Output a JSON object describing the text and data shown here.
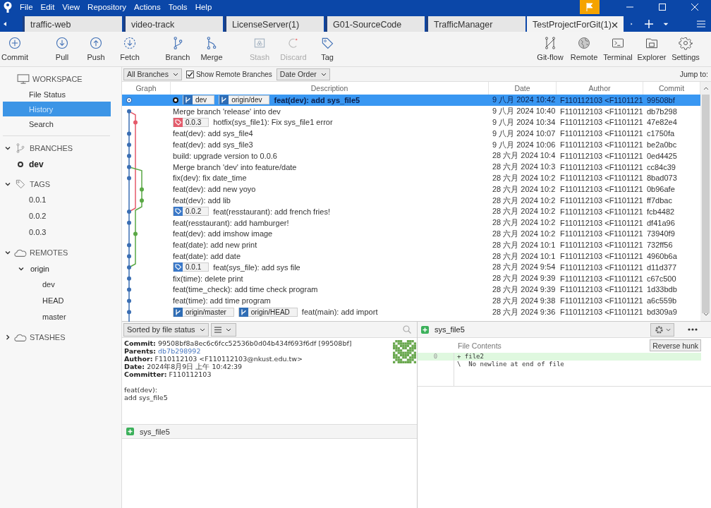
{
  "menu": [
    "File",
    "Edit",
    "View",
    "Repository",
    "Actions",
    "Tools",
    "Help"
  ],
  "tabs": [
    {
      "label": "traffic-web",
      "selected": false
    },
    {
      "label": "video-track",
      "selected": false
    },
    {
      "label": "LicenseServer(1)",
      "selected": false
    },
    {
      "label": "G01-SourceCode",
      "selected": false
    },
    {
      "label": "TrafficManager",
      "selected": false
    },
    {
      "label": "TestProjectForGit(1)",
      "selected": true
    }
  ],
  "toolbar": {
    "left": [
      {
        "label": "Commit",
        "kind": "commit",
        "disabled": false
      },
      {
        "label": "Pull",
        "kind": "pull",
        "disabled": false
      },
      {
        "label": "Push",
        "kind": "push",
        "disabled": false
      },
      {
        "label": "Fetch",
        "kind": "fetch",
        "disabled": false
      },
      {
        "label": "Branch",
        "kind": "branch",
        "disabled": false
      },
      {
        "label": "Merge",
        "kind": "merge",
        "disabled": false
      },
      {
        "label": "Stash",
        "kind": "stash",
        "disabled": true
      },
      {
        "label": "Discard",
        "kind": "discard",
        "disabled": true
      },
      {
        "label": "Tag",
        "kind": "tag",
        "disabled": false
      }
    ],
    "right": [
      {
        "label": "Git-flow",
        "kind": "gitflow",
        "disabled": false
      },
      {
        "label": "Remote",
        "kind": "remote",
        "disabled": false
      },
      {
        "label": "Terminal",
        "kind": "terminal",
        "disabled": false
      },
      {
        "label": "Explorer",
        "kind": "explorer",
        "disabled": false
      },
      {
        "label": "Settings",
        "kind": "settings",
        "disabled": false
      }
    ]
  },
  "sidebar": [
    {
      "title": "WORKSPACE",
      "kind": "workspace",
      "items": [
        {
          "label": "File Status",
          "selected": false
        },
        {
          "label": "History",
          "selected": true
        },
        {
          "label": "Search",
          "selected": false
        }
      ]
    },
    {
      "title": "BRANCHES",
      "kind": "branches",
      "expanded": true,
      "items": [
        {
          "label": "dev",
          "current": true
        }
      ]
    },
    {
      "title": "TAGS",
      "kind": "tags",
      "expanded": true,
      "items": [
        {
          "label": "0.0.1"
        },
        {
          "label": "0.0.2"
        },
        {
          "label": "0.0.3"
        }
      ]
    },
    {
      "title": "REMOTES",
      "kind": "remotes",
      "expanded": true,
      "items": [
        {
          "label": "origin",
          "expanded": true,
          "children": [
            {
              "label": "dev"
            },
            {
              "label": "HEAD"
            },
            {
              "label": "master"
            }
          ]
        }
      ]
    },
    {
      "title": "STASHES",
      "kind": "stashes",
      "expanded": false
    }
  ],
  "filters": {
    "branches": "All Branches",
    "show_remote": {
      "label": "Show Remote Branches",
      "checked": true
    },
    "order": "Date Order",
    "jump_label": "Jump to:"
  },
  "table": {
    "columns": [
      "Graph",
      "Description",
      "Date",
      "Author",
      "Commit"
    ],
    "rows": [
      {
        "selected": true,
        "head": true,
        "refs": [
          {
            "kind": "branch",
            "label": "dev"
          },
          {
            "kind": "branch",
            "label": "origin/dev"
          }
        ],
        "description": "feat(dev): add sys_file5",
        "date": "9 八月 2024 10:42",
        "author": "F110112103 <F1101121",
        "commit": "99508bf"
      },
      {
        "selected": false,
        "head": false,
        "description": "Merge branch 'release' into dev",
        "date": "9 八月 2024 10:40",
        "author": "F110112103 <F1101121",
        "commit": "db7b298"
      },
      {
        "selected": false,
        "head": false,
        "refs": [
          {
            "kind": "tag",
            "label": "0.0.3",
            "color": "#e45c6c"
          }
        ],
        "description": "hotfix(sys_file1): Fix sys_file1 error",
        "date": "9 八月 2024 10:34",
        "author": "F110112103 <F1101121",
        "commit": "47e82e4"
      },
      {
        "selected": false,
        "head": false,
        "description": "feat(dev): add sys_file4",
        "date": "9 八月 2024 10:07",
        "author": "F110112103 <F1101121",
        "commit": "c1750fa"
      },
      {
        "selected": false,
        "head": false,
        "description": "feat(dev): add sys_file3",
        "date": "9 八月 2024 10:06",
        "author": "F110112103 <F1101121",
        "commit": "be2a0bc"
      },
      {
        "selected": false,
        "head": false,
        "description": "build: upgrade version to 0.0.6",
        "date": "28 六月 2024 10:4",
        "author": "F110112103 <F1101121",
        "commit": "0ed4425"
      },
      {
        "selected": false,
        "head": false,
        "description": "Merge branch 'dev' into feature/date",
        "date": "28 六月 2024 10:3",
        "author": "F110112103 <F1101121",
        "commit": "cc84c39"
      },
      {
        "selected": false,
        "head": false,
        "description": "fix(dev): fix date_time",
        "date": "28 六月 2024 10:2",
        "author": "F110112103 <F1101121",
        "commit": "8bad073"
      },
      {
        "selected": false,
        "head": false,
        "description": "feat(dev): add new yoyo",
        "date": "28 六月 2024 10:2",
        "author": "F110112103 <F1101121",
        "commit": "0b96afe"
      },
      {
        "selected": false,
        "head": false,
        "description": "feat(dev): add lib",
        "date": "28 六月 2024 10:2",
        "author": "F110112103 <F1101121",
        "commit": "ff7dbac"
      },
      {
        "selected": false,
        "head": false,
        "refs": [
          {
            "kind": "tag",
            "label": "0.0.2",
            "color": "#3a78c8"
          }
        ],
        "description": "feat(resstaurant): add french fries!",
        "date": "28 六月 2024 10:2",
        "author": "F110112103 <F1101121",
        "commit": "fcb4482"
      },
      {
        "selected": false,
        "head": false,
        "description": "feat(resstaurant): add hamburger!",
        "date": "28 六月 2024 10:2",
        "author": "F110112103 <F1101121",
        "commit": "df41a96"
      },
      {
        "selected": false,
        "head": false,
        "description": "feat(dev): add imshow image",
        "date": "28 六月 2024 10:2",
        "author": "F110112103 <F1101121",
        "commit": "73940f9"
      },
      {
        "selected": false,
        "head": false,
        "description": "feat(date): add new print",
        "date": "28 六月 2024 10:1",
        "author": "F110112103 <F1101121",
        "commit": "732ff56"
      },
      {
        "selected": false,
        "head": false,
        "description": "feat(date): add date",
        "date": "28 六月 2024 10:1",
        "author": "F110112103 <F1101121",
        "commit": "4960b6a"
      },
      {
        "selected": false,
        "head": false,
        "refs": [
          {
            "kind": "tag",
            "label": "0.0.1",
            "color": "#3a78c8"
          }
        ],
        "description": "feat(sys_file): add sys file",
        "date": "28 六月 2024 9:54",
        "author": "F110112103 <F1101121",
        "commit": "d11d377"
      },
      {
        "selected": false,
        "head": false,
        "description": "fix(time): delete print",
        "date": "28 六月 2024 9:39",
        "author": "F110112103 <F1101121",
        "commit": "c67c500"
      },
      {
        "selected": false,
        "head": false,
        "description": "feat(time_check): add time check program",
        "date": "28 六月 2024 9:39",
        "author": "F110112103 <F1101121",
        "commit": "1d33bdb"
      },
      {
        "selected": false,
        "head": false,
        "description": "feat(time): add time program",
        "date": "28 六月 2024 9:38",
        "author": "F110112103 <F1101121",
        "commit": "a6c559b"
      },
      {
        "selected": false,
        "head": false,
        "refs": [
          {
            "kind": "branch",
            "label": "origin/master"
          },
          {
            "kind": "branch",
            "label": "origin/HEAD"
          }
        ],
        "description": "feat(main): add import",
        "date": "28 六月 2024 9:36",
        "author": "F110112103 <F1101121",
        "commit": "bd309a9"
      }
    ]
  },
  "details": {
    "sort": "Sorted by file status",
    "fields": [
      {
        "label": "Commit:",
        "value": "99508bf8a8ec6c6fcc52536b0d04b434f693f6df [99508bf]"
      },
      {
        "label": "Parents:",
        "value": "db7b298992",
        "kind": "link"
      },
      {
        "label": "Author:",
        "value": "F110112103 <F110112103@nkust.edu.tw>"
      },
      {
        "label": "Date:",
        "value": "2024年8月9日 上午 10:42:39"
      },
      {
        "label": "Committer:",
        "value": "F110112103"
      }
    ],
    "message": [
      "feat(dev):",
      "add sys_file5"
    ]
  },
  "files": [
    {
      "name": "sys_file5"
    }
  ],
  "diff": {
    "file": "sys_file5",
    "header": "File Contents",
    "button": "Reverse hunk",
    "lines": [
      {
        "number": "0",
        "text": "+ file2",
        "kind": "added"
      },
      {
        "text": "\\  No newline at end of file",
        "kind": "context"
      }
    ]
  }
}
